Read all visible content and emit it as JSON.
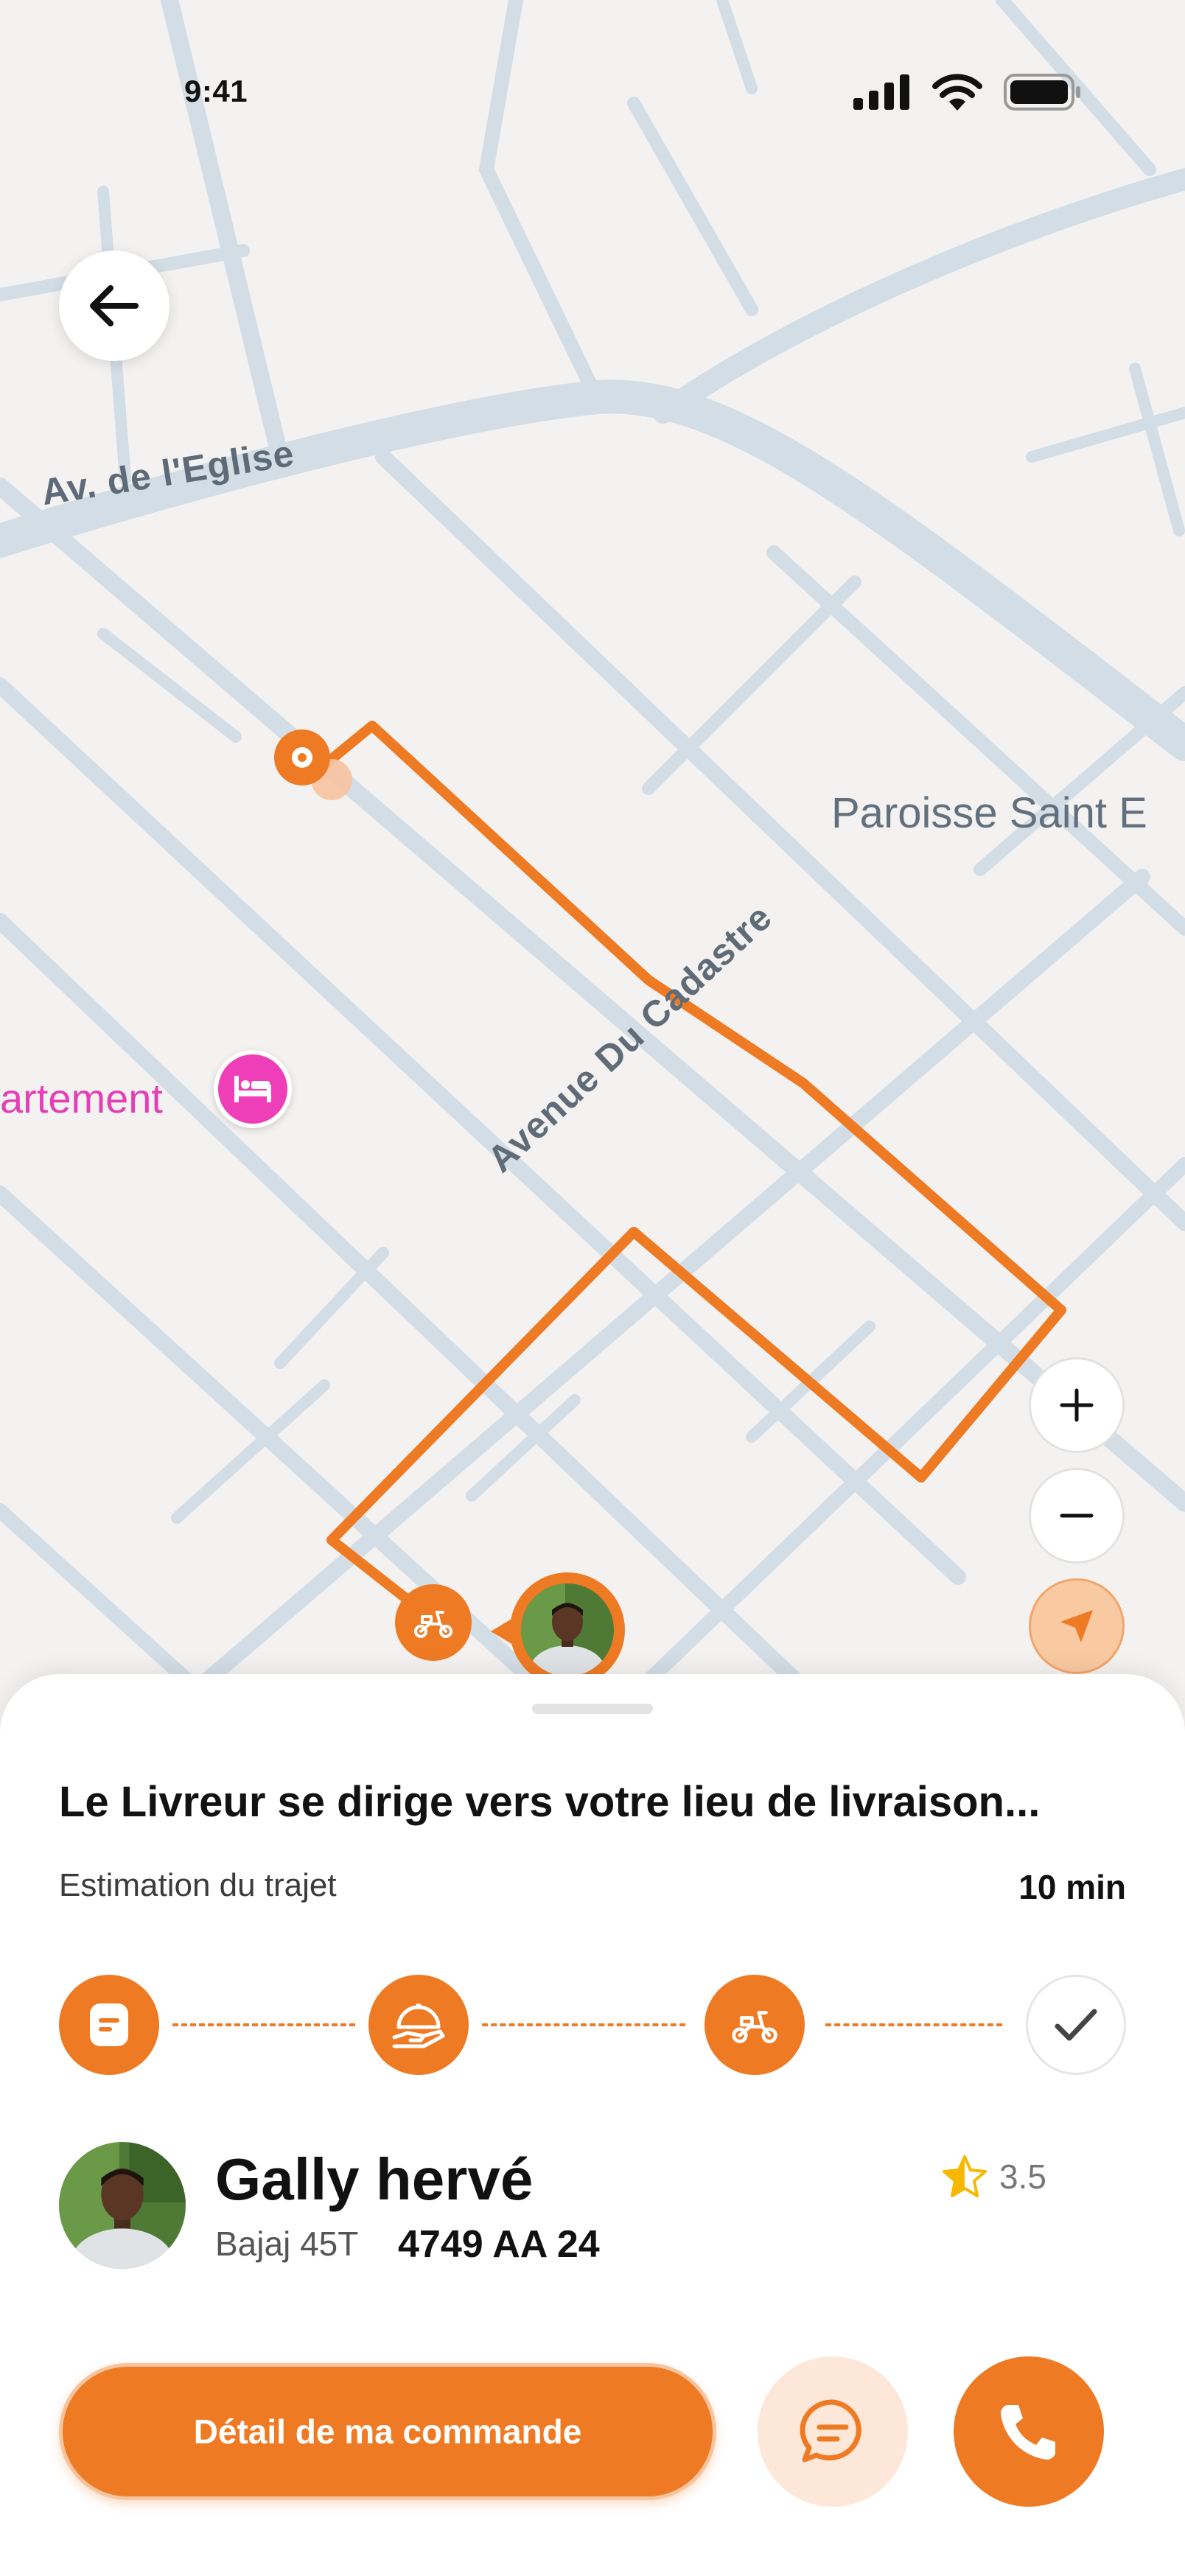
{
  "status_bar": {
    "time": "9:41"
  },
  "map": {
    "street_label_1": "Av. de l'Eglise",
    "street_label_2": "Avenue Du Cadastre",
    "poi_label_1": "Paroisse Saint E",
    "poi_label_2": "artement",
    "route_color": "#EF7A24",
    "poi_color": "#E33FB6"
  },
  "icons": {
    "back": "arrow-left-icon",
    "zoom_in": "plus-icon",
    "zoom_out": "minus-icon",
    "locate": "location-arrow-icon",
    "hotel": "bed-icon",
    "scooter": "scooter-icon",
    "order": "receipt-icon",
    "food": "cloche-icon",
    "check": "check-icon",
    "star": "star-half-icon",
    "chat": "chat-bubble-icon",
    "phone": "phone-icon"
  },
  "tracking": {
    "status": "Le Livreur se dirige vers votre lieu de livraison...",
    "eta_label": "Estimation du trajet",
    "eta_value": "10 min",
    "steps_completed": 3,
    "steps_total": 4
  },
  "driver": {
    "name": "Gally hervé",
    "vehicle": "Bajaj 45T",
    "plate": "4749 AA 24",
    "rating": "3.5"
  },
  "actions": {
    "order_details": "Détail de ma commande"
  },
  "theme": {
    "accent": "#EF7A24",
    "accent_light": "#FDE7D9"
  }
}
